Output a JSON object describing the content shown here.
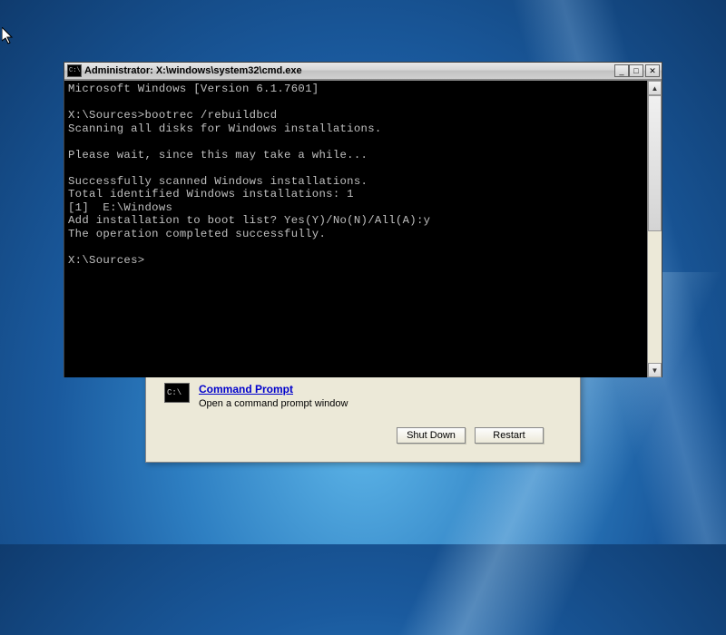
{
  "desktop": {
    "cursor": true
  },
  "recovery": {
    "tool": {
      "icon_text": "C:\\",
      "link": "Command Prompt",
      "description": "Open a command prompt window"
    },
    "buttons": {
      "shutdown": "Shut Down",
      "restart": "Restart"
    }
  },
  "cmd": {
    "title": "Administrator: X:\\windows\\system32\\cmd.exe",
    "title_icon": "C:\\",
    "title_buttons": {
      "minimize": "_",
      "maximize": "□",
      "close": "✕"
    },
    "scroll": {
      "up": "▲",
      "down": "▼"
    },
    "lines": [
      "Microsoft Windows [Version 6.1.7601]",
      "",
      "X:\\Sources>bootrec /rebuildbcd",
      "Scanning all disks for Windows installations.",
      "",
      "Please wait, since this may take a while...",
      "",
      "Successfully scanned Windows installations.",
      "Total identified Windows installations: 1",
      "[1]  E:\\Windows",
      "Add installation to boot list? Yes(Y)/No(N)/All(A):y",
      "The operation completed successfully.",
      "",
      "X:\\Sources>"
    ]
  }
}
